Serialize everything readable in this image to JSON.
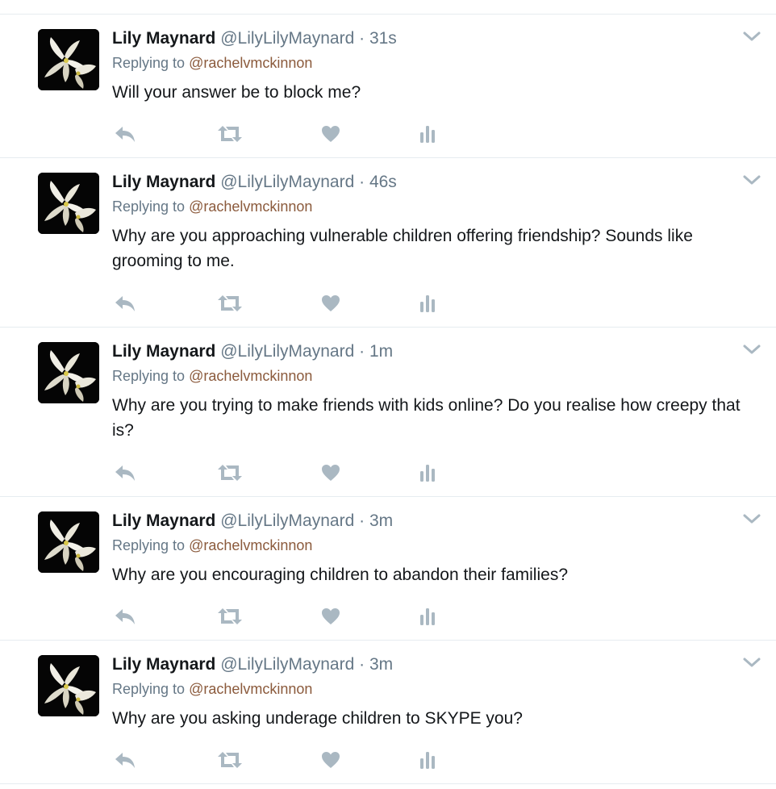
{
  "colors": {
    "name": "#14171a",
    "secondary": "#657786",
    "mention": "#8b5a3c",
    "icon": "#aab8c2",
    "divider": "#e6ecf0"
  },
  "icons": {
    "reply": "reply-icon",
    "retweet": "retweet-icon",
    "like": "heart-icon",
    "analytics": "analytics-icon",
    "more": "chevron-down-icon",
    "avatar": "white-lilies-avatar"
  },
  "tweets": [
    {
      "fullname": "Lily Maynard",
      "username": "@LilyLilyMaynard",
      "separator": "·",
      "time": "31s",
      "reply_prefix": "Replying to",
      "reply_to": "@rachelvmckinnon",
      "text": "Will your answer be to block me?"
    },
    {
      "fullname": "Lily Maynard",
      "username": "@LilyLilyMaynard",
      "separator": "·",
      "time": "46s",
      "reply_prefix": "Replying to",
      "reply_to": "@rachelvmckinnon",
      "text": "Why are you approaching vulnerable children offering friendship? Sounds like grooming to me."
    },
    {
      "fullname": "Lily Maynard",
      "username": "@LilyLilyMaynard",
      "separator": "·",
      "time": "1m",
      "reply_prefix": "Replying to",
      "reply_to": "@rachelvmckinnon",
      "text": "Why are you trying to make friends with kids online? Do you realise how creepy that is?"
    },
    {
      "fullname": "Lily Maynard",
      "username": "@LilyLilyMaynard",
      "separator": "·",
      "time": "3m",
      "reply_prefix": "Replying to",
      "reply_to": "@rachelvmckinnon",
      "text": "Why are you encouraging children to abandon their families?"
    },
    {
      "fullname": "Lily Maynard",
      "username": "@LilyLilyMaynard",
      "separator": "·",
      "time": "3m",
      "reply_prefix": "Replying to",
      "reply_to": "@rachelvmckinnon",
      "text": "Why are you asking underage children to SKYPE you?"
    }
  ]
}
